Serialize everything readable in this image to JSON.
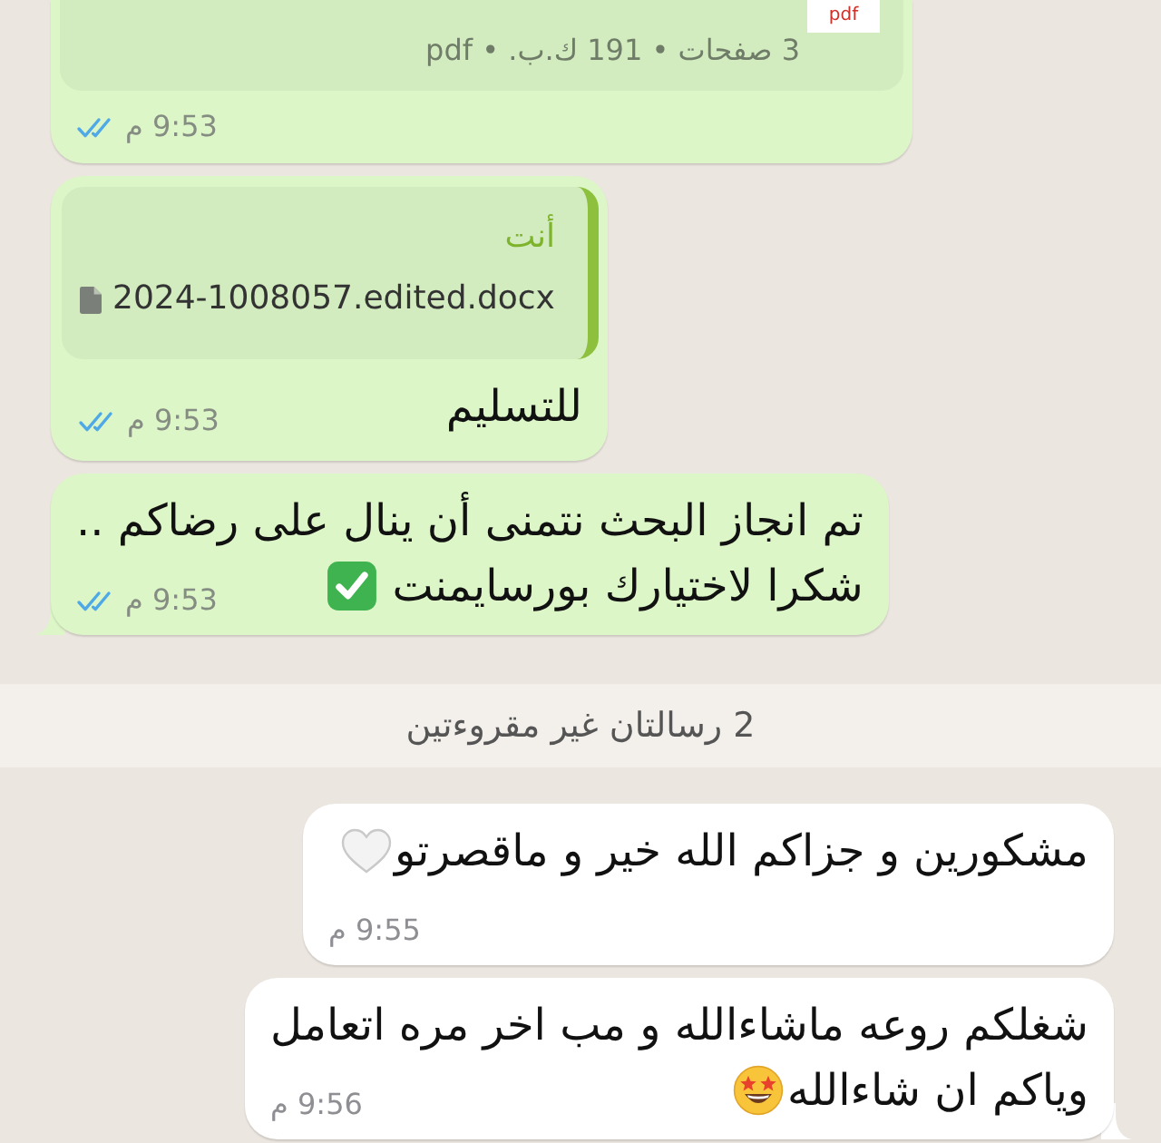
{
  "messages": [
    {
      "kind": "document",
      "outgoing": true,
      "tail": false,
      "read": true,
      "thumbnail_label": "pdf",
      "details": "3 صفحات • 191 ك.ب. • pdf",
      "time": "9:53 م"
    },
    {
      "kind": "reply",
      "outgoing": true,
      "tail": false,
      "read": true,
      "quote": {
        "author": "أنت",
        "file_name": "2024-1008057.edited.docx"
      },
      "lines": [
        "للتسليم"
      ],
      "time": "9:53 م"
    },
    {
      "kind": "text",
      "outgoing": true,
      "tail": true,
      "read": true,
      "lines": [
        "تم انجاز البحث نتمنى أن ينال على رضاكم ..",
        "شكرا لاختيارك بورسايمنت"
      ],
      "emoji": {
        "kind": "check_box"
      },
      "time": "9:53 م"
    },
    {
      "kind": "unread_banner",
      "text": "2 رسالتان غير مقروءتين"
    },
    {
      "kind": "text",
      "outgoing": false,
      "tail": false,
      "lines": [
        "مشكورين و جزاكم الله خير و ماقصرتو"
      ],
      "emoji": {
        "kind": "white_heart"
      },
      "time": "9:55 م"
    },
    {
      "kind": "text",
      "outgoing": false,
      "tail": true,
      "lines": [
        "شغلكم روعه ماشاءالله و مب اخر مره اتعامل",
        "وياكم ان شاءالله"
      ],
      "emoji": {
        "kind": "star_struck"
      },
      "time": "9:56 م"
    }
  ]
}
